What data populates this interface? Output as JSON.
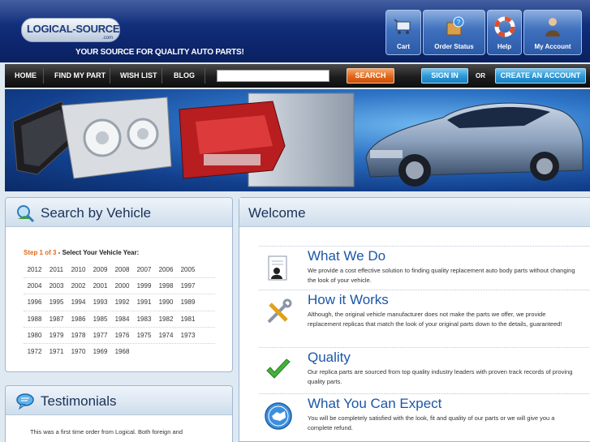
{
  "header": {
    "logo_text": "LOGICAL-SOURCE",
    "logo_sub": ".com",
    "tagline": "YOUR SOURCE FOR QUALITY AUTO PARTS!",
    "buttons": {
      "cart": "Cart",
      "order_status": "Order Status",
      "help": "Help",
      "my_account": "My Account"
    }
  },
  "nav": {
    "items": [
      "HOME",
      "FIND MY PART",
      "WISH LIST",
      "BLOG"
    ],
    "search_value": "",
    "search_button": "SEARCH",
    "signin": "SIGN IN",
    "or": "OR",
    "create_account": "CREATE AN ACCOUNT"
  },
  "search_vehicle": {
    "title": "Search by Vehicle",
    "step_label": "Step 1 of 3",
    "step_text": " - Select Your Vehicle Year:",
    "years": [
      [
        "2012",
        "2011",
        "2010",
        "2009",
        "2008",
        "2007",
        "2006",
        "2005"
      ],
      [
        "2004",
        "2003",
        "2002",
        "2001",
        "2000",
        "1999",
        "1998",
        "1997"
      ],
      [
        "1996",
        "1995",
        "1994",
        "1993",
        "1992",
        "1991",
        "1990",
        "1989"
      ],
      [
        "1988",
        "1987",
        "1986",
        "1985",
        "1984",
        "1983",
        "1982",
        "1981"
      ],
      [
        "1980",
        "1979",
        "1978",
        "1977",
        "1976",
        "1975",
        "1974",
        "1973"
      ],
      [
        "1972",
        "1971",
        "1970",
        "1969",
        "1968"
      ]
    ]
  },
  "testimonials": {
    "title": "Testimonials",
    "text": "This was a first time order from Logical. Both foreign and"
  },
  "welcome": {
    "title": "Welcome",
    "features": [
      {
        "title": "What We Do",
        "text": "We provide a cost effective solution to finding quality replacement auto body parts without changing the look of your vehicle."
      },
      {
        "title": "How it Works",
        "text": "Although, the original vehicle manufacturer does not make the parts we offer, we provide replacement replicas that match the look of your original parts down to the details, guaranteed!"
      },
      {
        "title": "Quality",
        "text": "Our replica parts are sourced from top quality industry leaders with proven track records of proving quality parts."
      },
      {
        "title": "What You Can Expect",
        "text": "You will be completely satisfied with the look, fit and quality of our parts or we will give you a complete refund."
      }
    ]
  },
  "colors": {
    "header_blue": "#0f2a74",
    "accent_orange": "#e0651a",
    "accent_blue": "#2a96d4",
    "title_blue": "#1a57a8"
  }
}
